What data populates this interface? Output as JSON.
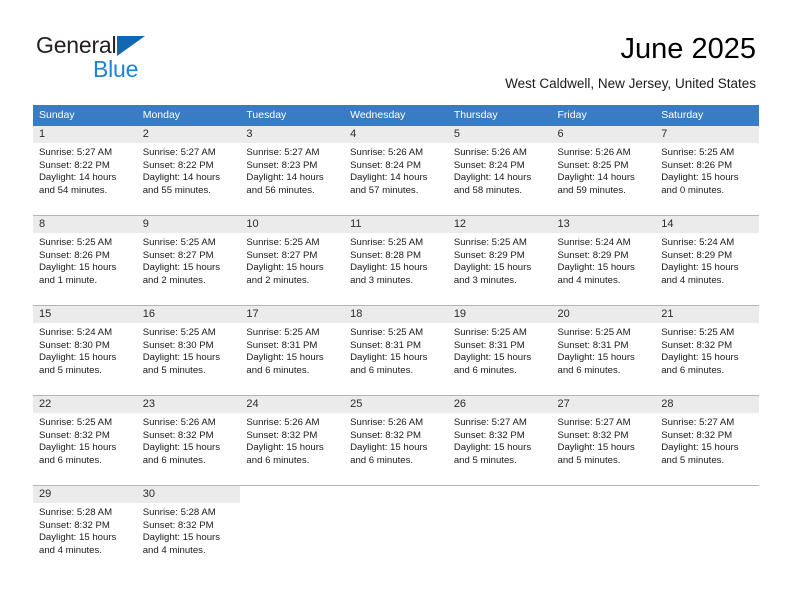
{
  "brand": {
    "name_part1": "General",
    "name_part2": "Blue",
    "triangle_icon": "brand-triangle-icon",
    "colors": {
      "dark_text": "#231f20",
      "blue_text": "#1b84d8",
      "triangle": "#1167b1"
    }
  },
  "header": {
    "title": "June 2025",
    "subtitle": "West Caldwell, New Jersey, United States"
  },
  "theme": {
    "header_row_bg": "#3a7cc4",
    "header_row_text": "#ffffff",
    "daynum_band_bg": "#ebebeb",
    "cell_bg": "#ffffff",
    "row_divider": "#b5b5b5"
  },
  "weekday_headers": [
    "Sunday",
    "Monday",
    "Tuesday",
    "Wednesday",
    "Thursday",
    "Friday",
    "Saturday"
  ],
  "labels": {
    "sunrise_prefix": "Sunrise:",
    "sunset_prefix": "Sunset:",
    "daylight_prefix": "Daylight:"
  },
  "weeks": [
    [
      {
        "day": "1",
        "sunrise": "Sunrise: 5:27 AM",
        "sunset": "Sunset: 8:22 PM",
        "daylight": "Daylight: 14 hours and 54 minutes."
      },
      {
        "day": "2",
        "sunrise": "Sunrise: 5:27 AM",
        "sunset": "Sunset: 8:22 PM",
        "daylight": "Daylight: 14 hours and 55 minutes."
      },
      {
        "day": "3",
        "sunrise": "Sunrise: 5:27 AM",
        "sunset": "Sunset: 8:23 PM",
        "daylight": "Daylight: 14 hours and 56 minutes."
      },
      {
        "day": "4",
        "sunrise": "Sunrise: 5:26 AM",
        "sunset": "Sunset: 8:24 PM",
        "daylight": "Daylight: 14 hours and 57 minutes."
      },
      {
        "day": "5",
        "sunrise": "Sunrise: 5:26 AM",
        "sunset": "Sunset: 8:24 PM",
        "daylight": "Daylight: 14 hours and 58 minutes."
      },
      {
        "day": "6",
        "sunrise": "Sunrise: 5:26 AM",
        "sunset": "Sunset: 8:25 PM",
        "daylight": "Daylight: 14 hours and 59 minutes."
      },
      {
        "day": "7",
        "sunrise": "Sunrise: 5:25 AM",
        "sunset": "Sunset: 8:26 PM",
        "daylight": "Daylight: 15 hours and 0 minutes."
      }
    ],
    [
      {
        "day": "8",
        "sunrise": "Sunrise: 5:25 AM",
        "sunset": "Sunset: 8:26 PM",
        "daylight": "Daylight: 15 hours and 1 minute."
      },
      {
        "day": "9",
        "sunrise": "Sunrise: 5:25 AM",
        "sunset": "Sunset: 8:27 PM",
        "daylight": "Daylight: 15 hours and 2 minutes."
      },
      {
        "day": "10",
        "sunrise": "Sunrise: 5:25 AM",
        "sunset": "Sunset: 8:27 PM",
        "daylight": "Daylight: 15 hours and 2 minutes."
      },
      {
        "day": "11",
        "sunrise": "Sunrise: 5:25 AM",
        "sunset": "Sunset: 8:28 PM",
        "daylight": "Daylight: 15 hours and 3 minutes."
      },
      {
        "day": "12",
        "sunrise": "Sunrise: 5:25 AM",
        "sunset": "Sunset: 8:29 PM",
        "daylight": "Daylight: 15 hours and 3 minutes."
      },
      {
        "day": "13",
        "sunrise": "Sunrise: 5:24 AM",
        "sunset": "Sunset: 8:29 PM",
        "daylight": "Daylight: 15 hours and 4 minutes."
      },
      {
        "day": "14",
        "sunrise": "Sunrise: 5:24 AM",
        "sunset": "Sunset: 8:29 PM",
        "daylight": "Daylight: 15 hours and 4 minutes."
      }
    ],
    [
      {
        "day": "15",
        "sunrise": "Sunrise: 5:24 AM",
        "sunset": "Sunset: 8:30 PM",
        "daylight": "Daylight: 15 hours and 5 minutes."
      },
      {
        "day": "16",
        "sunrise": "Sunrise: 5:25 AM",
        "sunset": "Sunset: 8:30 PM",
        "daylight": "Daylight: 15 hours and 5 minutes."
      },
      {
        "day": "17",
        "sunrise": "Sunrise: 5:25 AM",
        "sunset": "Sunset: 8:31 PM",
        "daylight": "Daylight: 15 hours and 6 minutes."
      },
      {
        "day": "18",
        "sunrise": "Sunrise: 5:25 AM",
        "sunset": "Sunset: 8:31 PM",
        "daylight": "Daylight: 15 hours and 6 minutes."
      },
      {
        "day": "19",
        "sunrise": "Sunrise: 5:25 AM",
        "sunset": "Sunset: 8:31 PM",
        "daylight": "Daylight: 15 hours and 6 minutes."
      },
      {
        "day": "20",
        "sunrise": "Sunrise: 5:25 AM",
        "sunset": "Sunset: 8:31 PM",
        "daylight": "Daylight: 15 hours and 6 minutes."
      },
      {
        "day": "21",
        "sunrise": "Sunrise: 5:25 AM",
        "sunset": "Sunset: 8:32 PM",
        "daylight": "Daylight: 15 hours and 6 minutes."
      }
    ],
    [
      {
        "day": "22",
        "sunrise": "Sunrise: 5:25 AM",
        "sunset": "Sunset: 8:32 PM",
        "daylight": "Daylight: 15 hours and 6 minutes."
      },
      {
        "day": "23",
        "sunrise": "Sunrise: 5:26 AM",
        "sunset": "Sunset: 8:32 PM",
        "daylight": "Daylight: 15 hours and 6 minutes."
      },
      {
        "day": "24",
        "sunrise": "Sunrise: 5:26 AM",
        "sunset": "Sunset: 8:32 PM",
        "daylight": "Daylight: 15 hours and 6 minutes."
      },
      {
        "day": "25",
        "sunrise": "Sunrise: 5:26 AM",
        "sunset": "Sunset: 8:32 PM",
        "daylight": "Daylight: 15 hours and 6 minutes."
      },
      {
        "day": "26",
        "sunrise": "Sunrise: 5:27 AM",
        "sunset": "Sunset: 8:32 PM",
        "daylight": "Daylight: 15 hours and 5 minutes."
      },
      {
        "day": "27",
        "sunrise": "Sunrise: 5:27 AM",
        "sunset": "Sunset: 8:32 PM",
        "daylight": "Daylight: 15 hours and 5 minutes."
      },
      {
        "day": "28",
        "sunrise": "Sunrise: 5:27 AM",
        "sunset": "Sunset: 8:32 PM",
        "daylight": "Daylight: 15 hours and 5 minutes."
      }
    ],
    [
      {
        "day": "29",
        "sunrise": "Sunrise: 5:28 AM",
        "sunset": "Sunset: 8:32 PM",
        "daylight": "Daylight: 15 hours and 4 minutes."
      },
      {
        "day": "30",
        "sunrise": "Sunrise: 5:28 AM",
        "sunset": "Sunset: 8:32 PM",
        "daylight": "Daylight: 15 hours and 4 minutes."
      },
      {
        "day": "",
        "sunrise": "",
        "sunset": "",
        "daylight": ""
      },
      {
        "day": "",
        "sunrise": "",
        "sunset": "",
        "daylight": ""
      },
      {
        "day": "",
        "sunrise": "",
        "sunset": "",
        "daylight": ""
      },
      {
        "day": "",
        "sunrise": "",
        "sunset": "",
        "daylight": ""
      },
      {
        "day": "",
        "sunrise": "",
        "sunset": "",
        "daylight": ""
      }
    ]
  ]
}
